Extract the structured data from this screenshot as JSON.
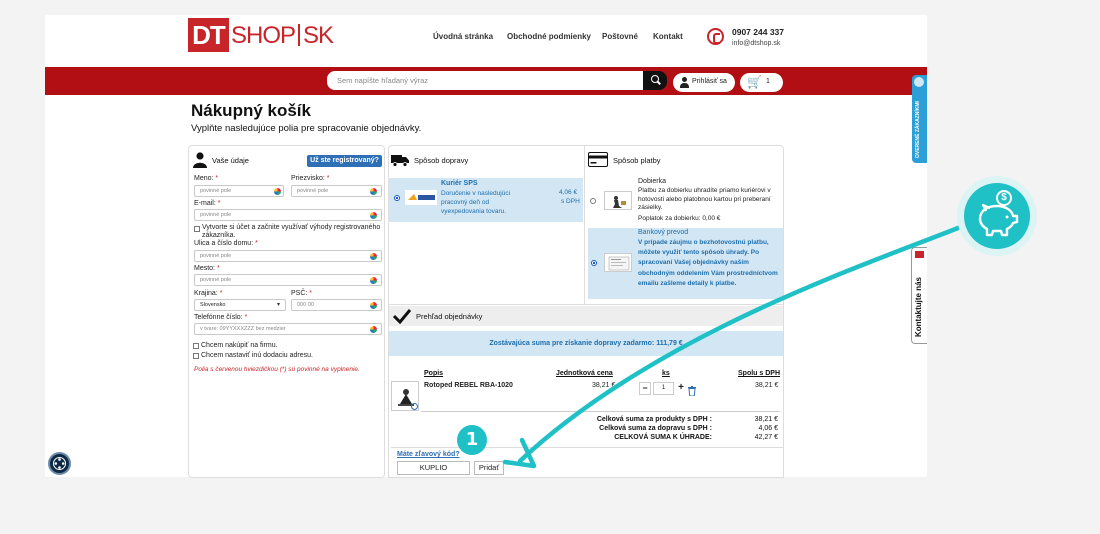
{
  "header": {
    "logo_dt": "DT",
    "logo_shop": "SHOP",
    "logo_sk": "SK",
    "nav": [
      "Úvodná stránka",
      "Obchodné podmienky",
      "Poštovné",
      "Kontakt"
    ],
    "phone": "0907 244 337",
    "email": "info@dtshop.sk"
  },
  "searchbar": {
    "placeholder": "Sem napíšte hľadaný výraz",
    "login_label": "Prihlásiť sa",
    "cart_count": "1"
  },
  "page": {
    "title": "Nákupný košík",
    "subtitle": "Vyplňte nasledujúce polia pre spracovanie objednávky."
  },
  "details": {
    "title": "Vaše údaje",
    "registered_button": "Už ste registrovaný?",
    "name_label": "Meno:",
    "surname_label": "Priezvisko:",
    "email_label": "E-mail:",
    "street_label": "Ulica a číslo domu:",
    "city_label": "Mesto:",
    "country_label": "Krajina:",
    "zip_label": "PSČ:",
    "phone_label": "Telefónne číslo:",
    "required_placeholder": "povinné pole",
    "country_value": "Slovensko",
    "zip_placeholder": "000 00",
    "phone_placeholder": "v tvare: 09YYXXXZZZ bez medzier",
    "create_account": "Vytvorte si účet a začnite využívať výhody registrovaného zákazníka.",
    "company_purchase": "Chcem nakúpiť na firmu.",
    "delivery_address": "Chcem nastaviť inú dodaciu adresu.",
    "required_note": "Polia s červenou hviezdičkou (*) sú povinné na vyplnenie.",
    "asterisk": "*"
  },
  "shipping": {
    "title": "Spôsob dopravy",
    "option_name": "Kuriér SPS",
    "option_desc": "Doručenie v nasledujúci pracovný deň od vyexpedovania tovaru.",
    "price": "4,06 €",
    "price_note": "s DPH"
  },
  "payment": {
    "title": "Spôsob platby",
    "cod_name": "Dobierka",
    "cod_desc": "Platbu za dobierku uhradíte priamo kuriérovi v hotovosti alebo platobnou kartou pri preberaní zásielky.",
    "cod_fee": "Poplatok za dobierku: 0,00 €",
    "transfer_name": "Bankový prevod",
    "transfer_desc": "V prípade záujmu o bezhotovostnú platbu, môžete využiť tento spôsob úhrady. Po spracovaní Vašej objednávky naším obchodným oddelením Vám prostredníctvom emailu zašleme detaily k platbe."
  },
  "overview": {
    "title": "Prehľad objednávky",
    "free_shipping": "Zostávajúca suma pre získanie dopravy zadarmo: 111,79 €",
    "col_desc": "Popis",
    "col_unit": "Jednotková cena",
    "col_qty": "ks",
    "col_total": "Spolu s DPH",
    "item_name": "Rotoped REBEL RBA-1020",
    "item_unit_price": "38,21 €",
    "item_qty": "1",
    "item_total": "38,21 €",
    "qty_minus": "−",
    "qty_plus": "+",
    "sum_products_label": "Celková suma za produkty  s DPH :",
    "sum_products_value": "38,21 €",
    "sum_shipping_label": "Celková suma za dopravu  s DPH :",
    "sum_shipping_value": "4,06 €",
    "sum_total_label": "CELKOVÁ SUMA K ÚHRADE:",
    "sum_total_value": "42,27 €"
  },
  "coupon": {
    "link": "Máte zľavový kód?",
    "value": "KUPLIO",
    "button": "Pridať"
  },
  "sidebars": {
    "verified": "OVERENÉ ZÁKAZNÍKMI",
    "contact": "Kontaktujte nás"
  },
  "annotation": {
    "step": "1",
    "coin_symbol": "$"
  },
  "colors": {
    "brand_red": "#c8252b",
    "bar_red": "#b10f14",
    "accent_blue": "#1d6fae",
    "highlight_blue": "#d2e6f4",
    "annotation_teal": "#1fc1c6"
  }
}
